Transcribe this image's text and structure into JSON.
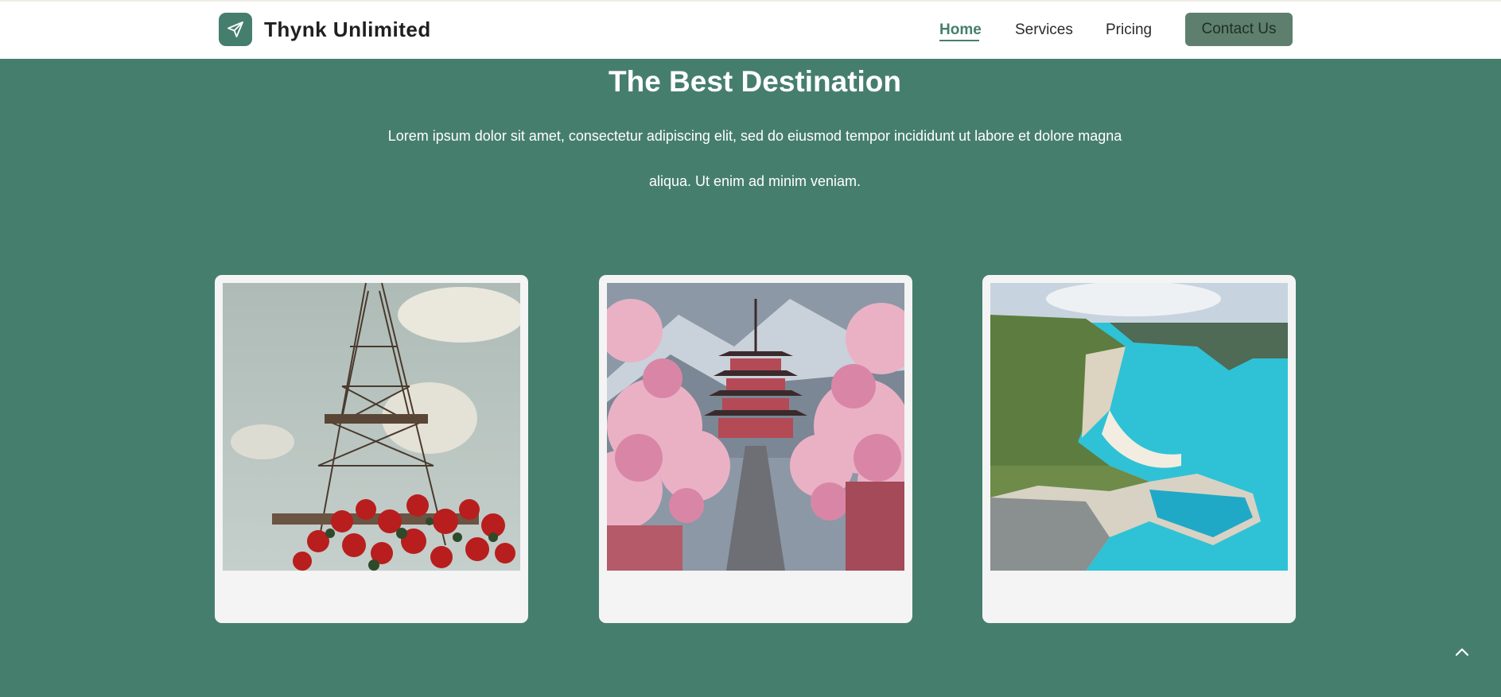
{
  "header": {
    "brand": "Thynk Unlimited",
    "logo_icon": "paper-plane-icon",
    "nav": [
      {
        "label": "Home",
        "active": true
      },
      {
        "label": "Services",
        "active": false
      },
      {
        "label": "Pricing",
        "active": false
      }
    ],
    "contact_label": "Contact Us"
  },
  "hero": {
    "title": "The Best Destination",
    "text_line1": "Lorem ipsum dolor sit amet, consectetur adipiscing elit, sed do eiusmod tempor incididunt ut labore et dolore magna",
    "text_line2": "aliqua. Ut enim ad minim veniam."
  },
  "cards": [
    {
      "image": "eiffel-tower-with-red-roses"
    },
    {
      "image": "japanese-pagoda-cherry-blossoms"
    },
    {
      "image": "coastal-cliffs-turquoise-sea"
    }
  ],
  "scroll_top_icon": "chevron-up-icon",
  "colors": {
    "background": "#467e6e",
    "nav_background": "#ffffff",
    "accent": "#467e6e",
    "contact_button": "#5e7f6d",
    "card_background": "#f4f4f4"
  }
}
